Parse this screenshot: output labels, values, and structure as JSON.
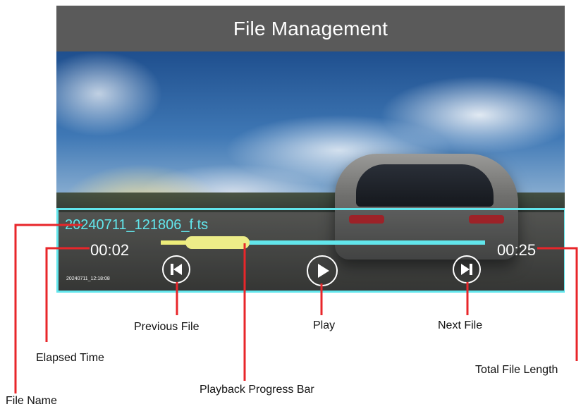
{
  "screen": {
    "title": "File Management",
    "file_name": "20240711_121806_f.ts",
    "elapsed_time": "00:02",
    "total_length": "00:25",
    "timestamp": "20240711_12:18:08",
    "progress_fraction": 0.08
  },
  "callouts": {
    "previous_file": "Previous File",
    "play": "Play",
    "next_file": "Next File",
    "elapsed_time": "Elapsed Time",
    "total_file_length": "Total File Length",
    "playback_progress_bar": "Playback Progress Bar",
    "file_name": "File Name"
  },
  "icons": {
    "previous": "skip-previous-icon",
    "play": "play-icon",
    "next": "skip-next-icon"
  },
  "colors": {
    "accent": "#62e6ec",
    "progress": "#eded88",
    "callout_line": "#e8262a",
    "title_bar": "#5a5a5a"
  }
}
